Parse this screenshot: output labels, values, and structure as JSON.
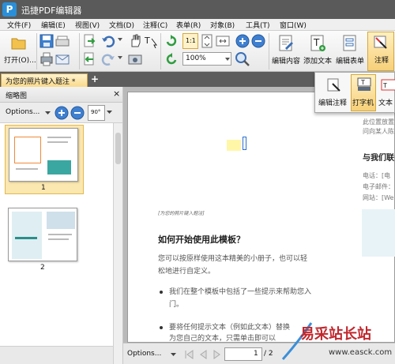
{
  "app": {
    "title": "迅捷PDF编辑器",
    "logo": "P"
  },
  "menu": [
    "文件(F)",
    "编辑(E)",
    "视图(V)",
    "文档(D)",
    "注释(C)",
    "表单(R)",
    "对象(B)",
    "工具(T)",
    "窗口(W)"
  ],
  "toolbar": {
    "open_label": "打开(O)...",
    "zoom_value": "100%",
    "edit_content_label": "编辑内容",
    "add_text_label": "添加文本",
    "edit_form_label": "编辑表单",
    "comment_label": "注释",
    "fit_page_label": "1:1"
  },
  "tab": {
    "label": "为您的照片键入题注 *",
    "add_symbol": "+"
  },
  "sidebar": {
    "title": "缩略图",
    "close": "×",
    "options_label": "Options...",
    "rotate_label": "90°",
    "thumb_pages": [
      "1",
      "2"
    ]
  },
  "popup": {
    "edit_annotation_label": "编辑注释",
    "typewriter_label": "打字机",
    "text_label": "文本"
  },
  "document": {
    "right_col_line1": "此位置放置",
    "right_col_line2": "问向某人陈",
    "contact_heading": "与我们联",
    "phone": "电话：[电",
    "email": "电子邮件：",
    "website": "网站：[We",
    "caption": "[为您的照片键入题注]",
    "heading": "如何开始使用此模板？",
    "para": "您可以按原样使用这本精美的小册子，也可以轻松地进行自定义。",
    "bullet1": "我们在整个模板中包括了一些提示来帮助您入门。",
    "bullet2": "要将任何提示文本（例如此文本）替换",
    "bullet3": "为您自己的文本，只需单击即可以"
  },
  "statusbar": {
    "options_label": "Options...",
    "page_value": "1",
    "page_total": "/ 2"
  },
  "watermark": {
    "text": "易采站长站",
    "url": "www.easck.com"
  },
  "colors": {
    "accent": "#f5a623",
    "tab_active": "#f9d98b",
    "titlebar": "#5a5a5a",
    "selection": "#f0c05a"
  }
}
